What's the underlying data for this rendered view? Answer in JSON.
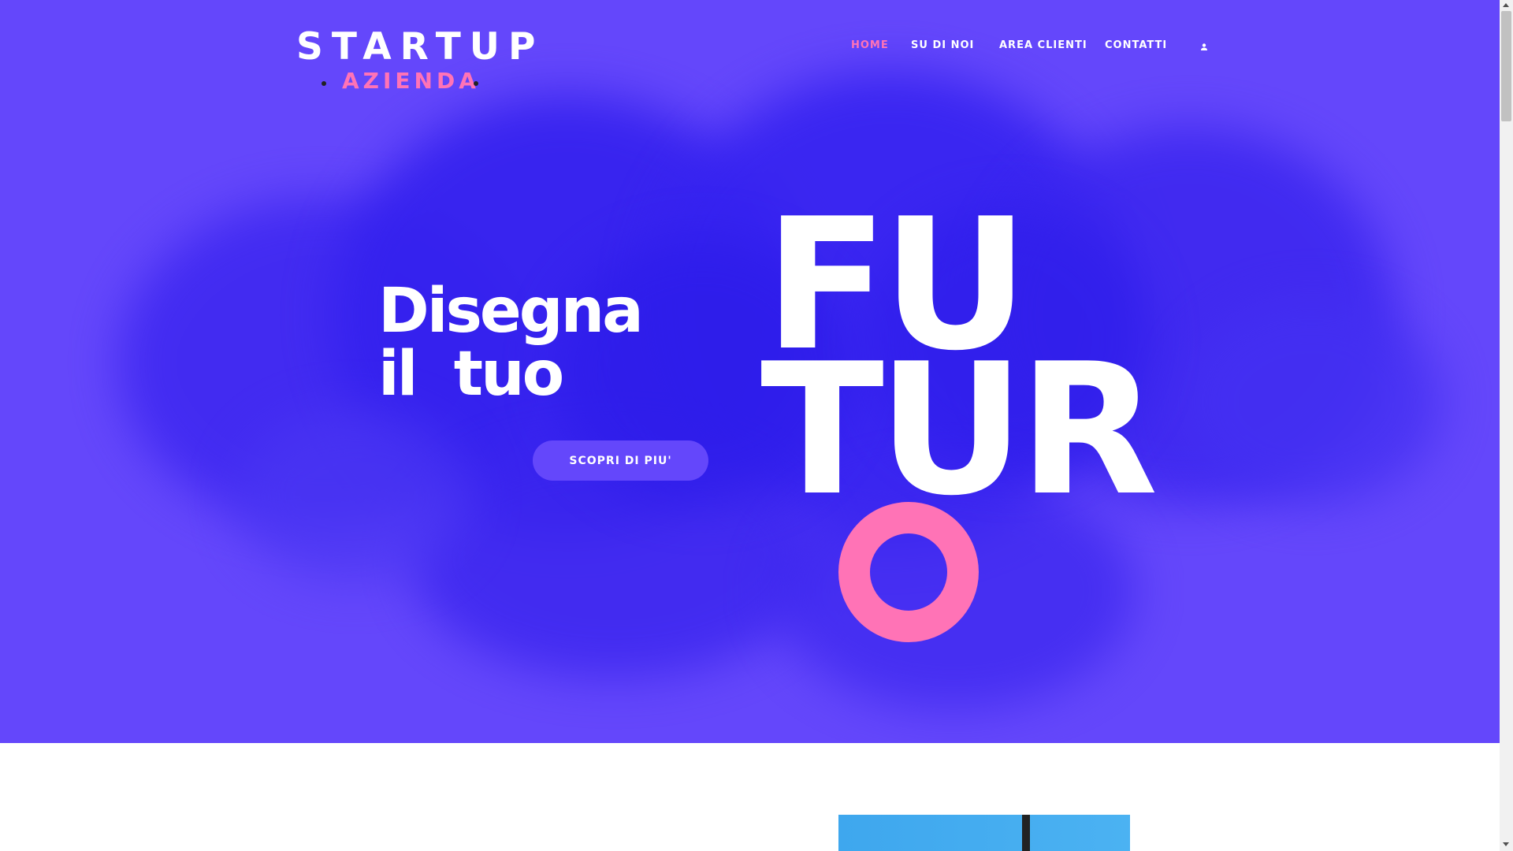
{
  "brand": {
    "main": "STARTUP",
    "sub": "AZIENDA"
  },
  "nav": {
    "items": [
      {
        "label": "HOME",
        "active": true
      },
      {
        "label": "SU DI NOI",
        "active": false
      },
      {
        "label": "AREA CLIENTI",
        "active": false
      },
      {
        "label": "CONTATTI",
        "active": false
      }
    ],
    "user_icon": "user-icon"
  },
  "hero": {
    "headline_line1": "Disegna",
    "headline_line2": "il  tuo",
    "cta_label": "SCOPRI DI PIU'",
    "big_word_line1": "FU",
    "big_word_line2": "TUR",
    "big_word_ring": "O"
  },
  "colors": {
    "hero_background": "#6447fb",
    "accent_pink": "#ff73b6",
    "smoke_blue": "#3a23ef",
    "text_white": "#ffffff"
  }
}
